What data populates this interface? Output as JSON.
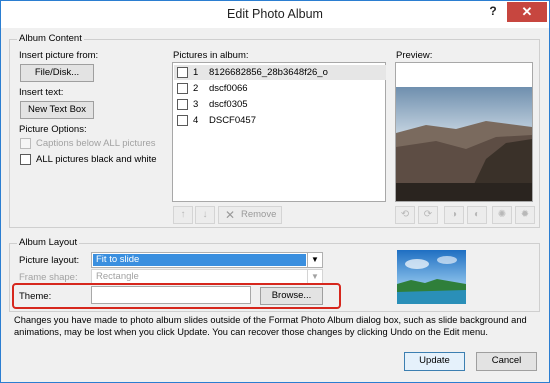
{
  "window": {
    "title": "Edit Photo Album",
    "help": "?",
    "close": "✕"
  },
  "album_content": {
    "group_label": "Album Content",
    "insert_picture_from": "Insert picture from:",
    "file_disk_button": "File/Disk...",
    "insert_text": "Insert text:",
    "new_text_box_button": "New Text Box",
    "picture_options": "Picture Options:",
    "captions_below": "Captions below ALL pictures",
    "all_black_white": "ALL pictures black and white"
  },
  "pictures": {
    "label": "Pictures in album:",
    "items": [
      {
        "num": "1",
        "name": "8126682856_28b3648f26_o"
      },
      {
        "num": "2",
        "name": "dscf0066"
      },
      {
        "num": "3",
        "name": "dscf0305"
      },
      {
        "num": "4",
        "name": "DSCF0457"
      }
    ],
    "remove_button": "Remove"
  },
  "preview": {
    "label": "Preview:"
  },
  "album_layout": {
    "group_label": "Album Layout",
    "picture_layout_label": "Picture layout:",
    "picture_layout_value": "Fit to slide",
    "frame_shape_label": "Frame shape:",
    "frame_shape_value": "Rectangle",
    "theme_label": "Theme:",
    "theme_value": "",
    "browse_button": "Browse..."
  },
  "note": "Changes you have made to photo album slides outside of the Format Photo Album dialog box, such as slide background and animations, may be lost when you click Update. You can recover those changes by clicking Undo on the Edit menu.",
  "footer": {
    "update_button": "Update",
    "cancel_button": "Cancel"
  },
  "colors": {
    "highlight_box": "#d6271d",
    "selection_blue": "#3a8fdf",
    "close_red": "#c7463f"
  }
}
